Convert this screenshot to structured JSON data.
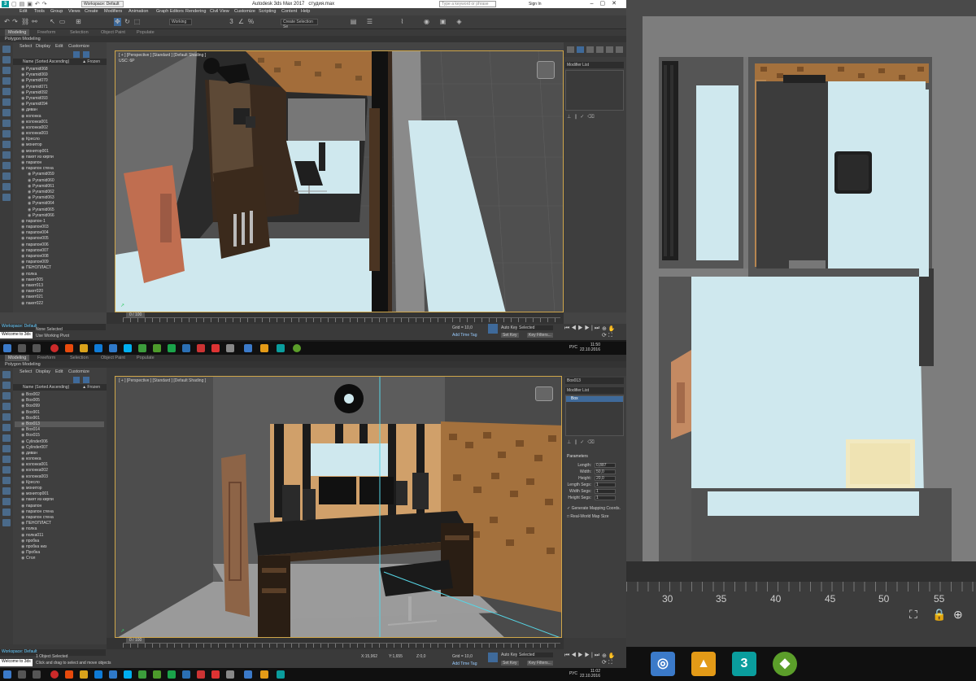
{
  "app": {
    "title": "Autodesk 3ds Max 2017",
    "file": "студия.max",
    "workspace": "Workspace: Default",
    "search_placeholder": "Type a keyword or phrase",
    "sign_in": "Sign In"
  },
  "menu": [
    "Edit",
    "Tools",
    "Group",
    "Views",
    "Create",
    "Modifiers",
    "Animation",
    "Graph Editors",
    "Rendering",
    "Civil View",
    "Customize",
    "Scripting",
    "Content",
    "Help"
  ],
  "toolbar": {
    "view_dropdown": "Working",
    "selection_set": "Create Selection Se"
  },
  "ribbon": {
    "tabs": [
      "Modeling",
      "Freeform",
      "Selection",
      "Object Paint",
      "Populate"
    ],
    "sub": "Polygon Modeling"
  },
  "scene_explorer": {
    "tabs": [
      "Select",
      "Display",
      "Edit",
      "Customize"
    ],
    "header": "Name (Sorted Ascending)",
    "frozen": "▲ Frozen",
    "top_list": [
      "Pyramid068",
      "Pyramid069",
      "Pyramid070",
      "Pyramid071",
      "Pyramid092",
      "Pyramid093",
      "Pyramid094",
      "диван",
      "колонка",
      "колонка001",
      "колонка002",
      "колонка003",
      "Кресло",
      "монитор",
      "монитор001",
      "пакет из кирпи",
      "парапон",
      "парапон стена",
      "Pyramid059",
      "Pyramid060",
      "Pyramid061",
      "Pyramid062",
      "Pyramid063",
      "Pyramid064",
      "Pyramid065",
      "Pyramid066",
      "парапон-1",
      "парапон003",
      "парапон004",
      "парапон005",
      "парапон006",
      "парапон007",
      "парапон008",
      "парапон009",
      "ПЕНОПЛАСТ",
      "полка",
      "пакет005",
      "пакет013",
      "пакет020",
      "пакет021",
      "пакет022"
    ],
    "bottom_list": [
      "Box002",
      "Box005",
      "Box099",
      "Box901",
      "Box901",
      "Box013",
      "Box014",
      "Box015",
      "Cylinder006",
      "Cylinder007",
      "диван",
      "колонка",
      "колонка001",
      "колонка002",
      "колонка003",
      "Кресло",
      "монитор",
      "монитор001",
      "пакет из кирпи",
      "парапон",
      "парапон стена",
      "парапон стена",
      "ПЕНОПЛАСТ",
      "полка",
      "полка011",
      "пробка",
      "пробка низ",
      "Пробка",
      "Стол"
    ]
  },
  "top_viewport": {
    "label": "[ + ] [Perspective ] [Standard ] [Default Shading ]",
    "stats": "USC: 6P"
  },
  "bottom_viewport": {
    "label": "[ + ] [Perspective ] [Standard ] [Default Shading ]"
  },
  "command_panel": {
    "modifier_list": "Modifier List",
    "object_name": "Box013",
    "modifier_item": "Box",
    "rollout": "Parameters",
    "params": [
      {
        "label": "Length:",
        "value": "0,887"
      },
      {
        "label": "Width:",
        "value": "50,0"
      },
      {
        "label": "Height:",
        "value": "20,0"
      },
      {
        "label": "Length Segs:",
        "value": "1"
      },
      {
        "label": "Width Segs:",
        "value": "1"
      },
      {
        "label": "Height Segs:",
        "value": "1"
      }
    ],
    "checks": [
      "Generate Mapping Coords.",
      "Real-World Map Size"
    ]
  },
  "timeline": {
    "frame": "0 / 100",
    "ticks": [
      "0",
      "5",
      "10",
      "15",
      "20",
      "25",
      "30",
      "35",
      "40",
      "45",
      "50",
      "55",
      "60",
      "65",
      "70",
      "75",
      "80",
      "85",
      "90",
      "95",
      "100"
    ]
  },
  "status_top": {
    "selected": "None Selected",
    "prompt": "Use Working Pivot",
    "listener": "Welcome to 3ds",
    "grid": "Grid = 10,0",
    "autokey": "Auto Key",
    "setkey": "Set Key",
    "selected_dd": "Selected",
    "keyfilters": "Key Filters...",
    "addtime": "Add Time Tag"
  },
  "status_bottom": {
    "selected": "1 Object Selected",
    "prompt": "Click and drag to select and move objects",
    "listener": "Welcome to 3ds",
    "x": "15,962",
    "y": "1,655",
    "z": "0,0",
    "grid": "Grid = 10,0",
    "autokey": "Auto Key",
    "setkey": "Set Key",
    "selected_dd": "Selected",
    "keyfilters": "Key Filters...",
    "addtime": "Add Time Tag"
  },
  "taskbar_top": {
    "lang": "РУС",
    "time": "11:50",
    "date": "22.10.2016"
  },
  "taskbar_bottom": {
    "lang": "РУС",
    "time": "11:02",
    "date": "22.10.2016"
  },
  "right_timeline": [
    "30",
    "35",
    "40",
    "45",
    "50",
    "55"
  ],
  "colors": {
    "accent_teal": "#0a9d9d",
    "floor_blue": "#cfe8ee",
    "wall_grey": "#7a7a7a",
    "panel_orange": "#c49a5a",
    "frame_gold": "#cfa64a"
  }
}
